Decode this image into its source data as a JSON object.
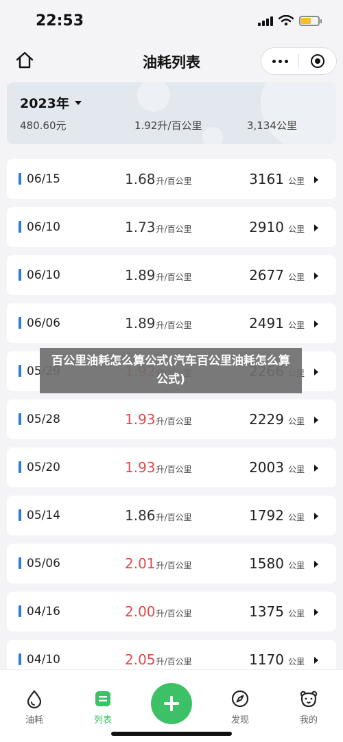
{
  "status": {
    "time": "22:53"
  },
  "nav": {
    "title": "油耗列表"
  },
  "summary": {
    "year": "2023年",
    "total_cost": "480.60元",
    "avg_consumption": "1.92升/百公里",
    "total_distance": "3,134公里"
  },
  "units": {
    "consumption": "升/百公里",
    "distance": "公里"
  },
  "records": [
    {
      "date": "06/15",
      "consumption": "1.68",
      "high": false,
      "distance": "3161"
    },
    {
      "date": "06/10",
      "consumption": "1.73",
      "high": false,
      "distance": "2910"
    },
    {
      "date": "06/10",
      "consumption": "1.89",
      "high": false,
      "distance": "2677"
    },
    {
      "date": "06/06",
      "consumption": "1.89",
      "high": false,
      "distance": "2491"
    },
    {
      "date": "05/29",
      "consumption": "1.92",
      "high": true,
      "distance": "2266"
    },
    {
      "date": "05/28",
      "consumption": "1.93",
      "high": true,
      "distance": "2229"
    },
    {
      "date": "05/20",
      "consumption": "1.93",
      "high": true,
      "distance": "2003"
    },
    {
      "date": "05/14",
      "consumption": "1.86",
      "high": false,
      "distance": "1792"
    },
    {
      "date": "05/06",
      "consumption": "2.01",
      "high": true,
      "distance": "1580"
    },
    {
      "date": "04/16",
      "consumption": "2.00",
      "high": true,
      "distance": "1375"
    },
    {
      "date": "04/10",
      "consumption": "2.05",
      "high": true,
      "distance": "1170"
    }
  ],
  "overlay": {
    "text": "百公里油耗怎么算公式(汽车百公里油耗怎么算公式)"
  },
  "tabs": [
    {
      "label": "油耗",
      "icon": "drop-icon",
      "active": false
    },
    {
      "label": "列表",
      "icon": "list-icon",
      "active": true
    },
    {
      "label": "",
      "icon": "plus-icon",
      "active": false
    },
    {
      "label": "发现",
      "icon": "compass-icon",
      "active": false
    },
    {
      "label": "我的",
      "icon": "bear-face-icon",
      "active": false
    }
  ],
  "colors": {
    "accent_green": "#3cc166",
    "marker_blue": "#2a7be4",
    "high_red": "#e24a4a"
  }
}
